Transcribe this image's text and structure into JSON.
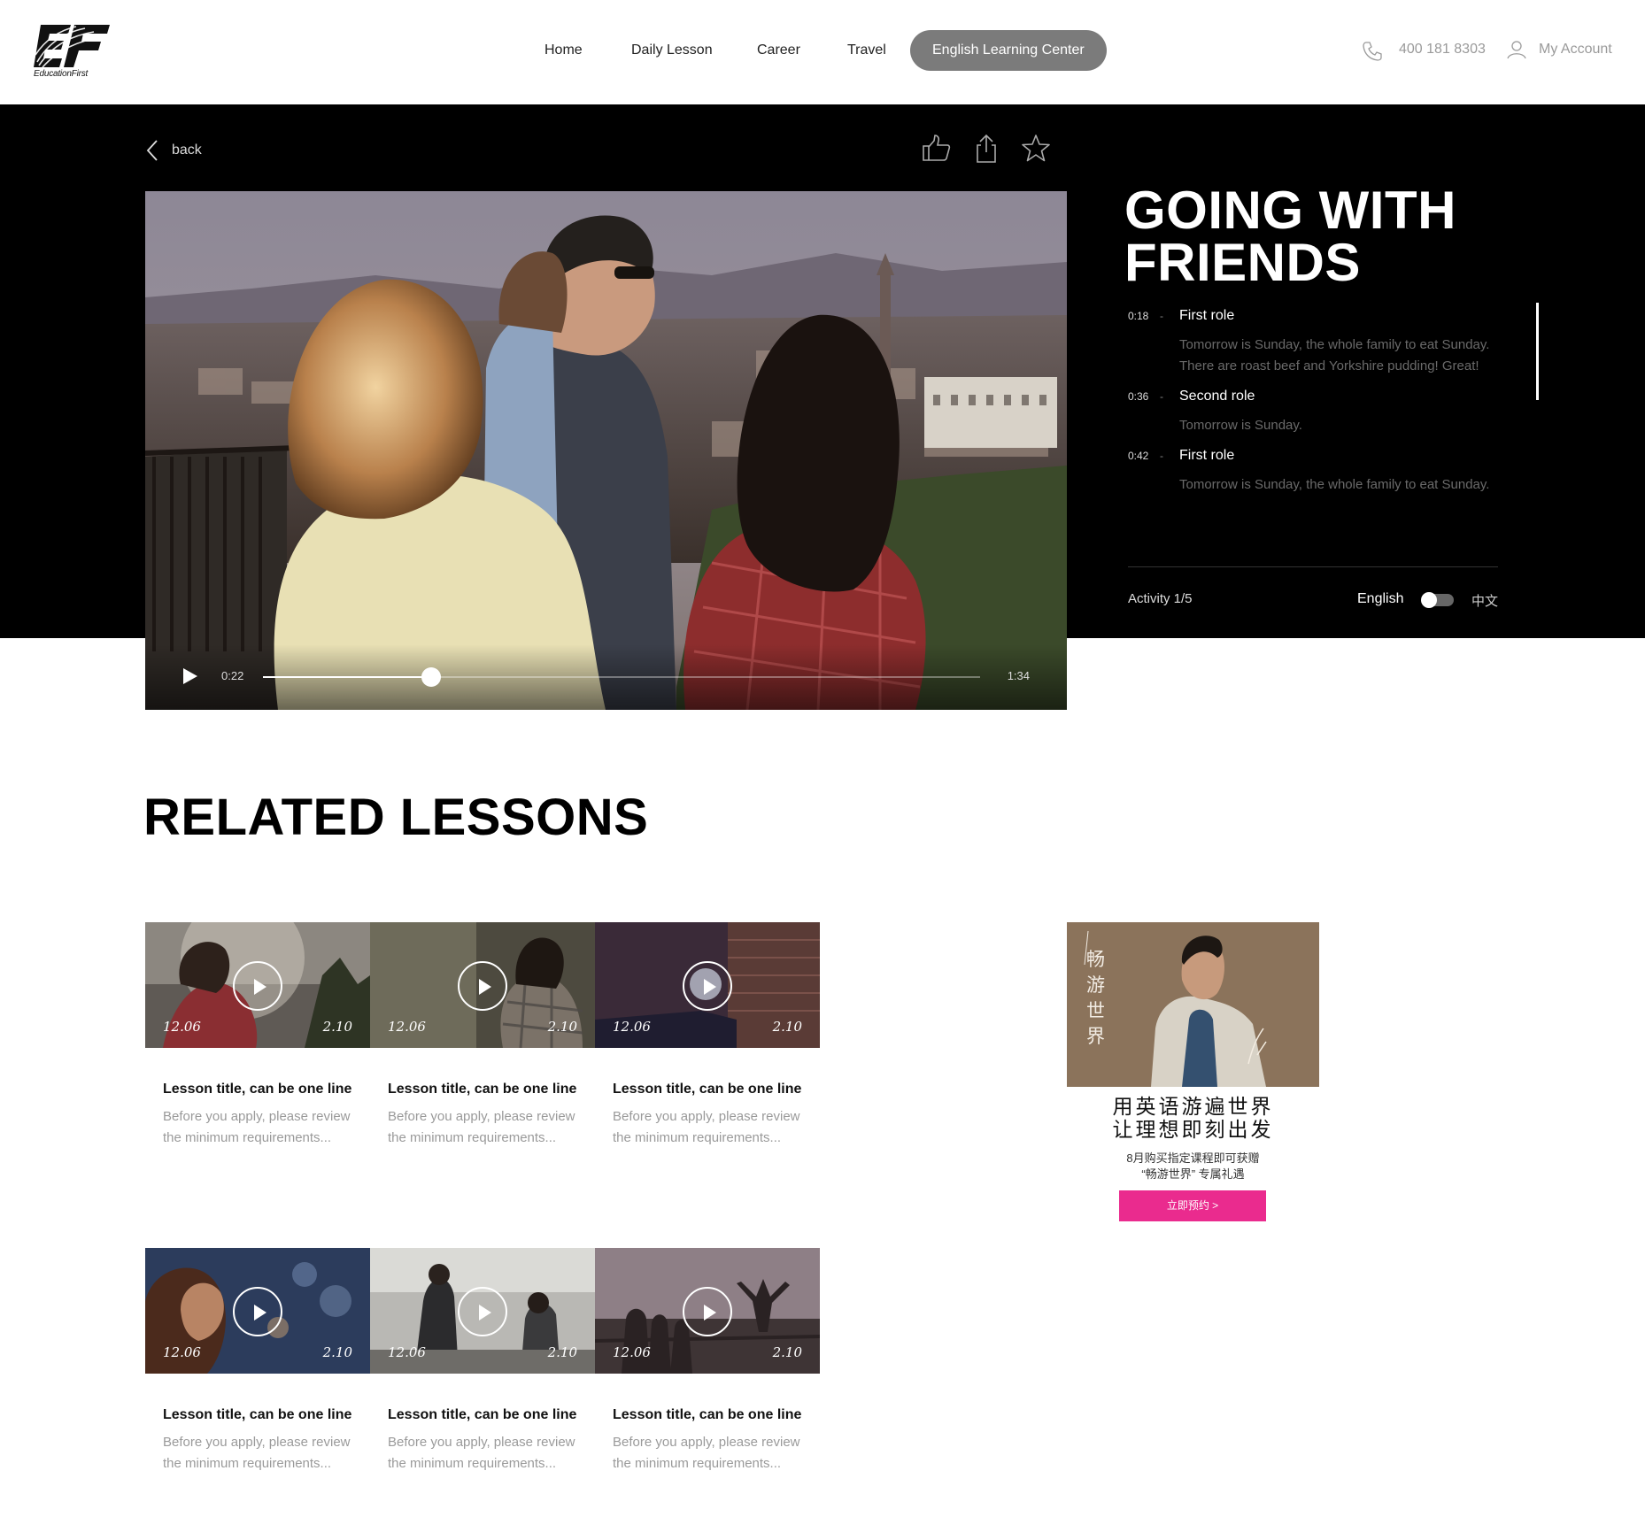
{
  "header": {
    "logo_text": "EducationFirst",
    "nav": [
      "Home",
      "Daily Lesson",
      "Career",
      "Travel",
      "English Learning Center"
    ],
    "active_nav": "English Learning Center",
    "phone": "400 181 8303",
    "account": "My Account"
  },
  "player": {
    "back_label": "back",
    "current_time": "0:22",
    "duration": "1:34",
    "progress_fraction": 0.234
  },
  "lesson": {
    "title": "GOING WITH FRIENDS",
    "transcript": [
      {
        "time": "0:18",
        "role": "First role",
        "text": "Tomorrow is Sunday, the whole family to eat Sunday. There are roast beef and Yorkshire pudding! Great!"
      },
      {
        "time": "0:36",
        "role": "Second role",
        "text": "Tomorrow is Sunday."
      },
      {
        "time": "0:42",
        "role": "First role",
        "text": "Tomorrow is Sunday, the whole family to eat Sunday."
      }
    ],
    "activity": "Activity 1/5",
    "lang_en": "English",
    "lang_cn": "中文"
  },
  "related": {
    "title": "RELATED LESSONS",
    "cards": [
      {
        "date_left": "12.06",
        "date_right": "2.10",
        "title": "Lesson title, can be one line",
        "desc": "Before you apply, please review the minimum requirements..."
      },
      {
        "date_left": "12.06",
        "date_right": "2.10",
        "title": "Lesson title, can be one line",
        "desc": "Before you apply, please review the minimum requirements..."
      },
      {
        "date_left": "12.06",
        "date_right": "2.10",
        "title": "Lesson title, can be one line",
        "desc": "Before you apply, please review the minimum requirements..."
      },
      {
        "date_left": "12.06",
        "date_right": "2.10",
        "title": "Lesson title, can be one line",
        "desc": "Before you apply, please review the minimum requirements..."
      },
      {
        "date_left": "12.06",
        "date_right": "2.10",
        "title": "Lesson title, can be one line",
        "desc": "Before you apply, please review the minimum requirements..."
      },
      {
        "date_left": "12.06",
        "date_right": "2.10",
        "title": "Lesson title, can be one line",
        "desc": "Before you apply, please review the minimum requirements..."
      }
    ]
  },
  "ad": {
    "vertical_text": "畅游世界",
    "headline_1": "用英语游遍世界",
    "headline_2": "让理想即刻出发",
    "sub_1": "8月购买指定课程即可获赠",
    "sub_2": "“畅游世界” 专属礼遇",
    "button": "立即预约 >"
  },
  "colors": {
    "accent": "#ea2b8e",
    "nav_active_bg": "#7b7b7b",
    "hero_bg": "#000000"
  }
}
